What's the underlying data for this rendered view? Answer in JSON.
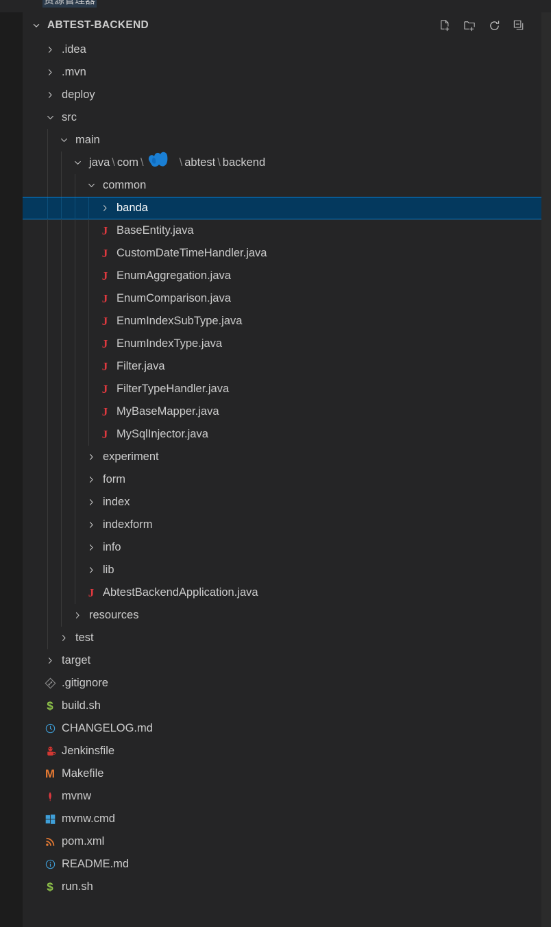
{
  "window": {
    "cut_label": "资源管理器",
    "panel_bg": "#252526",
    "selection_bg": "#04395e",
    "selection_border": "#0a84d8",
    "text_color": "#cccccc"
  },
  "header": {
    "title": "ABTEST-BACKEND",
    "twisty": "chevron-down-icon",
    "actions": [
      {
        "name": "new-file-icon",
        "tooltip": "New File"
      },
      {
        "name": "new-folder-icon",
        "tooltip": "New Folder"
      },
      {
        "name": "refresh-icon",
        "tooltip": "Refresh Explorer"
      },
      {
        "name": "collapse-all-icon",
        "tooltip": "Collapse Folders in Explorer"
      }
    ]
  },
  "tree": {
    "rows": [
      {
        "label": ".idea",
        "depth": 1,
        "kind": "folder",
        "state": "collapsed",
        "icon": "chevron-right-icon"
      },
      {
        "label": ".mvn",
        "depth": 1,
        "kind": "folder",
        "state": "collapsed",
        "icon": "chevron-right-icon"
      },
      {
        "label": "deploy",
        "depth": 1,
        "kind": "folder",
        "state": "collapsed",
        "icon": "chevron-right-icon"
      },
      {
        "label": "src",
        "depth": 1,
        "kind": "folder",
        "state": "expanded",
        "icon": "chevron-down-icon"
      },
      {
        "label": "main",
        "depth": 2,
        "kind": "folder",
        "state": "expanded",
        "icon": "chevron-down-icon"
      },
      {
        "label": "java\\com\\█\\abtest\\backend",
        "depth": 3,
        "kind": "folder-path",
        "state": "expanded",
        "icon": "chevron-down-icon",
        "segments": [
          "java",
          "com",
          "REDACTED",
          "abtest",
          "backend"
        ]
      },
      {
        "label": "common",
        "depth": 4,
        "kind": "folder",
        "state": "expanded",
        "icon": "chevron-down-icon"
      },
      {
        "label": "banda",
        "depth": 5,
        "kind": "folder",
        "state": "collapsed",
        "icon": "chevron-right-icon",
        "selected": true
      },
      {
        "label": "BaseEntity.java",
        "depth": 5,
        "kind": "file",
        "icon": "java-icon"
      },
      {
        "label": "CustomDateTimeHandler.java",
        "depth": 5,
        "kind": "file",
        "icon": "java-icon"
      },
      {
        "label": "EnumAggregation.java",
        "depth": 5,
        "kind": "file",
        "icon": "java-icon"
      },
      {
        "label": "EnumComparison.java",
        "depth": 5,
        "kind": "file",
        "icon": "java-icon"
      },
      {
        "label": "EnumIndexSubType.java",
        "depth": 5,
        "kind": "file",
        "icon": "java-icon"
      },
      {
        "label": "EnumIndexType.java",
        "depth": 5,
        "kind": "file",
        "icon": "java-icon"
      },
      {
        "label": "Filter.java",
        "depth": 5,
        "kind": "file",
        "icon": "java-icon"
      },
      {
        "label": "FilterTypeHandler.java",
        "depth": 5,
        "kind": "file",
        "icon": "java-icon"
      },
      {
        "label": "MyBaseMapper.java",
        "depth": 5,
        "kind": "file",
        "icon": "java-icon"
      },
      {
        "label": "MySqlInjector.java",
        "depth": 5,
        "kind": "file",
        "icon": "java-icon"
      },
      {
        "label": "experiment",
        "depth": 4,
        "kind": "folder",
        "state": "collapsed",
        "icon": "chevron-right-icon"
      },
      {
        "label": "form",
        "depth": 4,
        "kind": "folder",
        "state": "collapsed",
        "icon": "chevron-right-icon"
      },
      {
        "label": "index",
        "depth": 4,
        "kind": "folder",
        "state": "collapsed",
        "icon": "chevron-right-icon"
      },
      {
        "label": "indexform",
        "depth": 4,
        "kind": "folder",
        "state": "collapsed",
        "icon": "chevron-right-icon"
      },
      {
        "label": "info",
        "depth": 4,
        "kind": "folder",
        "state": "collapsed",
        "icon": "chevron-right-icon"
      },
      {
        "label": "lib",
        "depth": 4,
        "kind": "folder",
        "state": "collapsed",
        "icon": "chevron-right-icon"
      },
      {
        "label": "AbtestBackendApplication.java",
        "depth": 4,
        "kind": "file",
        "icon": "java-icon"
      },
      {
        "label": "resources",
        "depth": 3,
        "kind": "folder",
        "state": "collapsed",
        "icon": "chevron-right-icon"
      },
      {
        "label": "test",
        "depth": 2,
        "kind": "folder",
        "state": "collapsed",
        "icon": "chevron-right-icon"
      },
      {
        "label": "target",
        "depth": 1,
        "kind": "folder",
        "state": "collapsed",
        "icon": "chevron-right-icon"
      },
      {
        "label": ".gitignore",
        "depth": 1,
        "kind": "file",
        "icon": "git-icon"
      },
      {
        "label": "build.sh",
        "depth": 1,
        "kind": "file",
        "icon": "shell-icon"
      },
      {
        "label": "CHANGELOG.md",
        "depth": 1,
        "kind": "file",
        "icon": "changelog-clock-icon"
      },
      {
        "label": "Jenkinsfile",
        "depth": 1,
        "kind": "file",
        "icon": "jenkins-icon"
      },
      {
        "label": "Makefile",
        "depth": 1,
        "kind": "file",
        "icon": "makefile-icon"
      },
      {
        "label": "mvnw",
        "depth": 1,
        "kind": "file",
        "icon": "maven-feather-icon"
      },
      {
        "label": "mvnw.cmd",
        "depth": 1,
        "kind": "file",
        "icon": "windows-icon"
      },
      {
        "label": "pom.xml",
        "depth": 1,
        "kind": "file",
        "icon": "xml-feed-icon"
      },
      {
        "label": "README.md",
        "depth": 1,
        "kind": "file",
        "icon": "info-circle-icon"
      },
      {
        "label": "run.sh",
        "depth": 1,
        "kind": "file",
        "icon": "shell-icon"
      }
    ]
  }
}
